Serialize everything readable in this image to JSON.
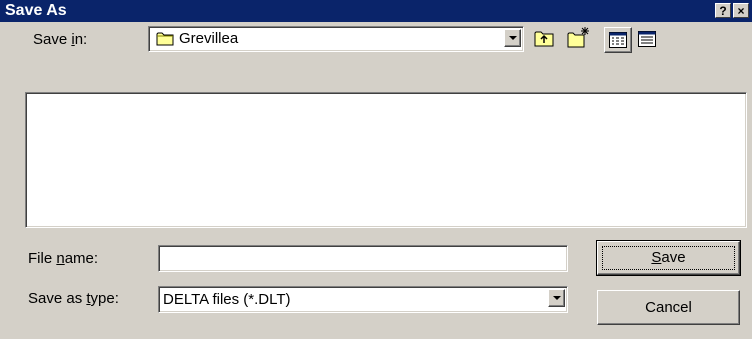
{
  "window": {
    "title": "Save As",
    "help_label": "?",
    "close_label": "×"
  },
  "save_in": {
    "label_before": "Save ",
    "label_accel": "i",
    "label_after": "n:",
    "value": "Grevillea"
  },
  "toolbar": {
    "icons": [
      "up-one-level-icon",
      "create-new-folder-icon",
      "list-view-icon",
      "details-view-icon"
    ]
  },
  "file_name": {
    "label_before": "File ",
    "label_accel": "n",
    "label_after": "ame:",
    "value": ""
  },
  "save_as_type": {
    "label_before": "Save as ",
    "label_accel": "t",
    "label_after": "ype:",
    "value": "DELTA files (*.DLT)"
  },
  "buttons": {
    "save_accel": "S",
    "save_rest": "ave",
    "cancel": "Cancel"
  },
  "colors": {
    "titlebar": "#0a246a",
    "face": "#d4d0c8"
  }
}
